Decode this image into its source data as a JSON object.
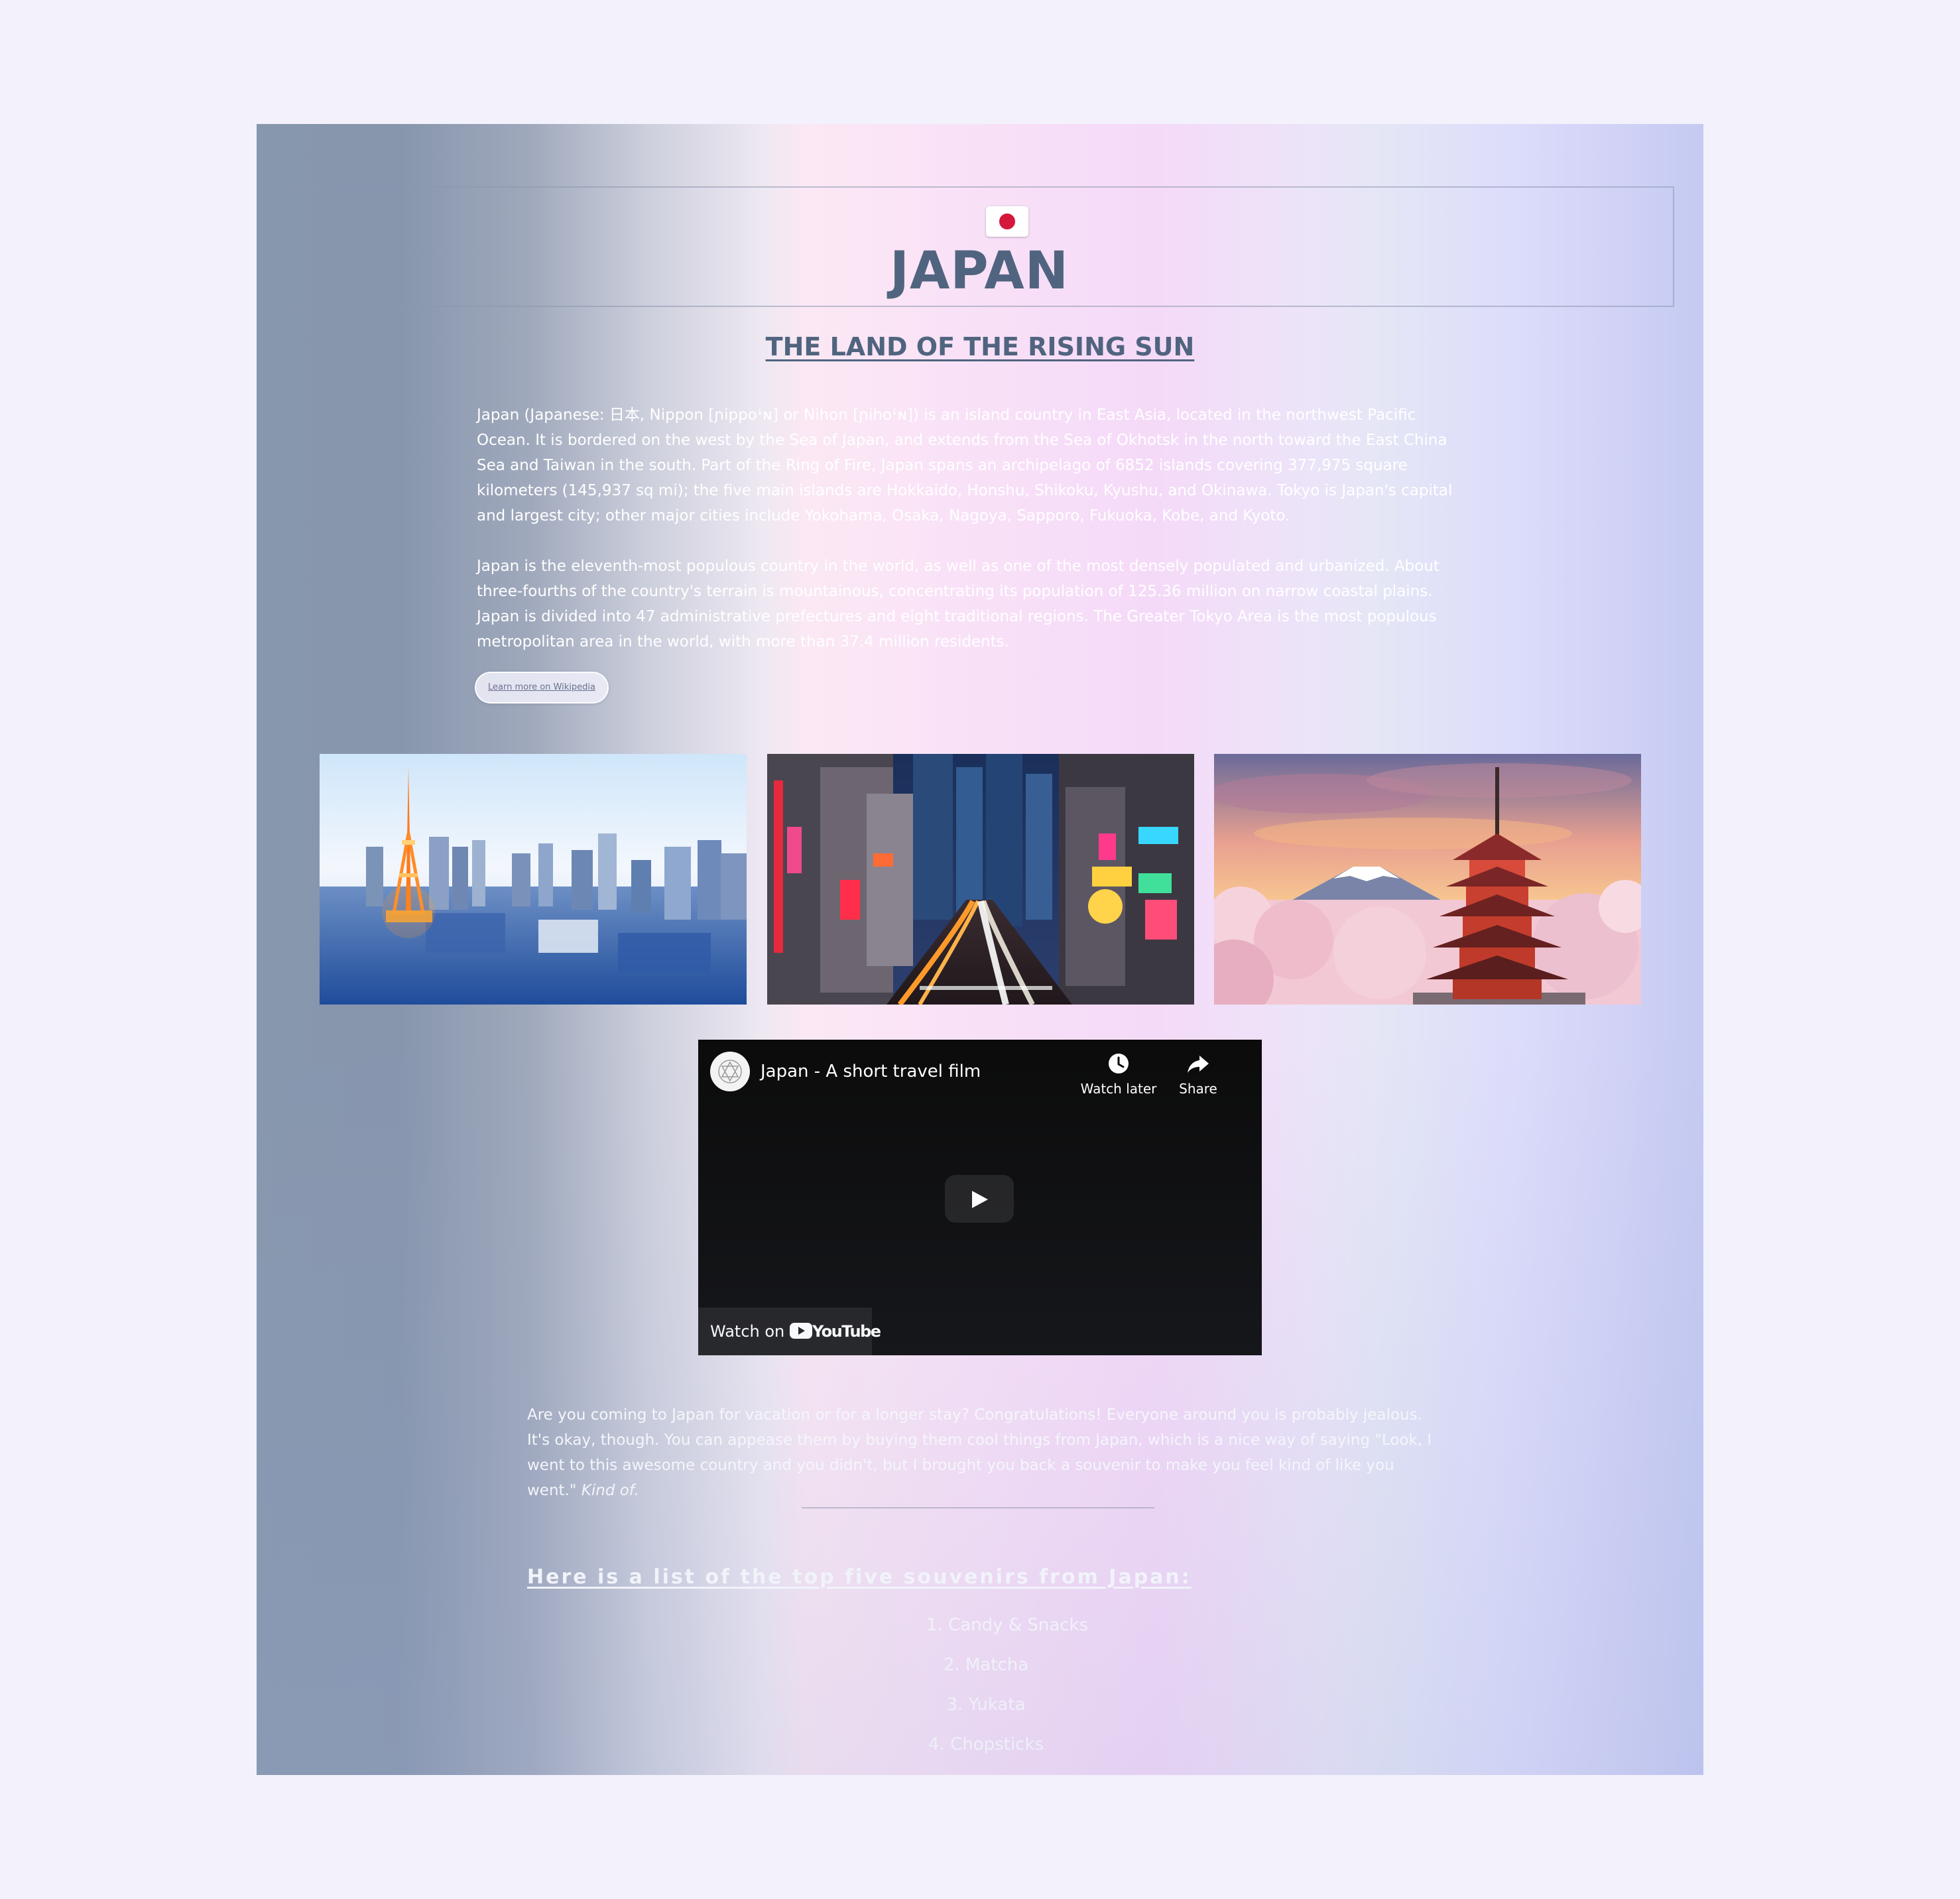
{
  "header": {
    "flag_icon": "japan-flag-icon",
    "title": "JAPAN",
    "subtitle": "THE LAND OF THE RISING SUN"
  },
  "intro": {
    "paragraphs": [
      "Japan (Japanese: 日本, Nippon [ɲippoꜜɴ] or Nihon [ɲihoꜜɴ]) is an island country in East Asia, located in the northwest Pacific Ocean. It is bordered on the west by the Sea of Japan, and extends from the Sea of Okhotsk in the north toward the East China Sea and Taiwan in the south. Part of the Ring of Fire, Japan spans an archipelago of 6852 islands covering 377,975 square kilometers (145,937 sq mi); the five main islands are Hokkaido, Honshu, Shikoku, Kyushu, and Okinawa. Tokyo is Japan's capital and largest city; other major cities include Yokohama, Osaka, Nagoya, Sapporo, Fukuoka, Kobe, and Kyoto.",
      "Japan is the eleventh-most populous country in the world, as well as one of the most densely populated and urbanized. About three-fourths of the country's terrain is mountainous, concentrating its population of 125.36 million on narrow coastal plains. Japan is divided into 47 administrative prefectures and eight traditional regions. The Greater Tokyo Area is the most populous metropolitan area in the world, with more than 37.4 million residents."
    ],
    "wiki_button": "Learn more on Wikipedia"
  },
  "video": {
    "title": "Japan - A short travel film",
    "watch_later": "Watch later",
    "share": "Share",
    "watch_on": "Watch on",
    "brand": "YouTube"
  },
  "outro": {
    "text": "Are you coming to Japan for vacation or for a longer stay? Congratulations! Everyone around you is probably jealous. It's okay, though. You can appease them by buying them cool things from Japan, which is a nice way of saying \"Look, I went to this awesome country and you didn't, but I brought you back a souvenir to make you feel kind of like you went.\"",
    "emphasis": "Kind of."
  },
  "souvenirs": {
    "heading": "Here is a list of the top five souvenirs from Japan:",
    "items": [
      "1. Candy & Snacks",
      "2. Matcha",
      "3. Yukata",
      "4. Chopsticks"
    ]
  },
  "colors": {
    "title": "#50647f",
    "flag_red": "#d4173a",
    "video_bg": "#0b0b0b",
    "youtube_red": "#ff0000"
  }
}
